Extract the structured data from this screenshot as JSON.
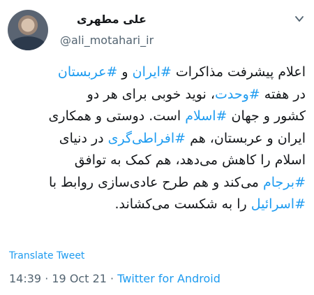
{
  "author": {
    "name": "علی مطهری",
    "handle": "@ali_motahari_ir"
  },
  "tweet_lines": [
    [
      {
        "t": "اعلام پیشرفت مذاکرات ",
        "tag": false
      },
      {
        "t": "#ایران",
        "tag": true
      },
      {
        "t": " و ",
        "tag": false
      },
      {
        "t": "#عربستان",
        "tag": true
      }
    ],
    [
      {
        "t": "در هفته ",
        "tag": false
      },
      {
        "t": "#وحدت",
        "tag": true
      },
      {
        "t": "، نوید خوبی برای هر دو",
        "tag": false
      }
    ],
    [
      {
        "t": "کشور و جهان ",
        "tag": false
      },
      {
        "t": "#اسلام",
        "tag": true
      },
      {
        "t": " است. دوستی و همکاری",
        "tag": false
      }
    ],
    [
      {
        "t": "ایران و عربستان، هم ",
        "tag": false
      },
      {
        "t": "#افراطی‌گری",
        "tag": true
      },
      {
        "t": " در دنیای",
        "tag": false
      }
    ],
    [
      {
        "t": "اسلام را کاهش می‌دهد، هم کمک به توافق",
        "tag": false
      }
    ],
    [
      {
        "t": "#برجام",
        "tag": true
      },
      {
        "t": " می‌کند و هم طرح عادی‌سازی روابط با",
        "tag": false
      }
    ],
    [
      {
        "t": "#اسرائیل",
        "tag": true
      },
      {
        "t": " را به شکست می‌کشاند.",
        "tag": false
      }
    ]
  ],
  "translate_label": "Translate Tweet",
  "meta": {
    "time": "14:39",
    "separator": " · ",
    "date": "19 Oct 21",
    "source": "Twitter for Android"
  },
  "icons": {
    "menu": "chevron-down-icon"
  },
  "colors": {
    "link": "#1d9bf0",
    "secondary": "#536471",
    "text": "#14171a"
  }
}
